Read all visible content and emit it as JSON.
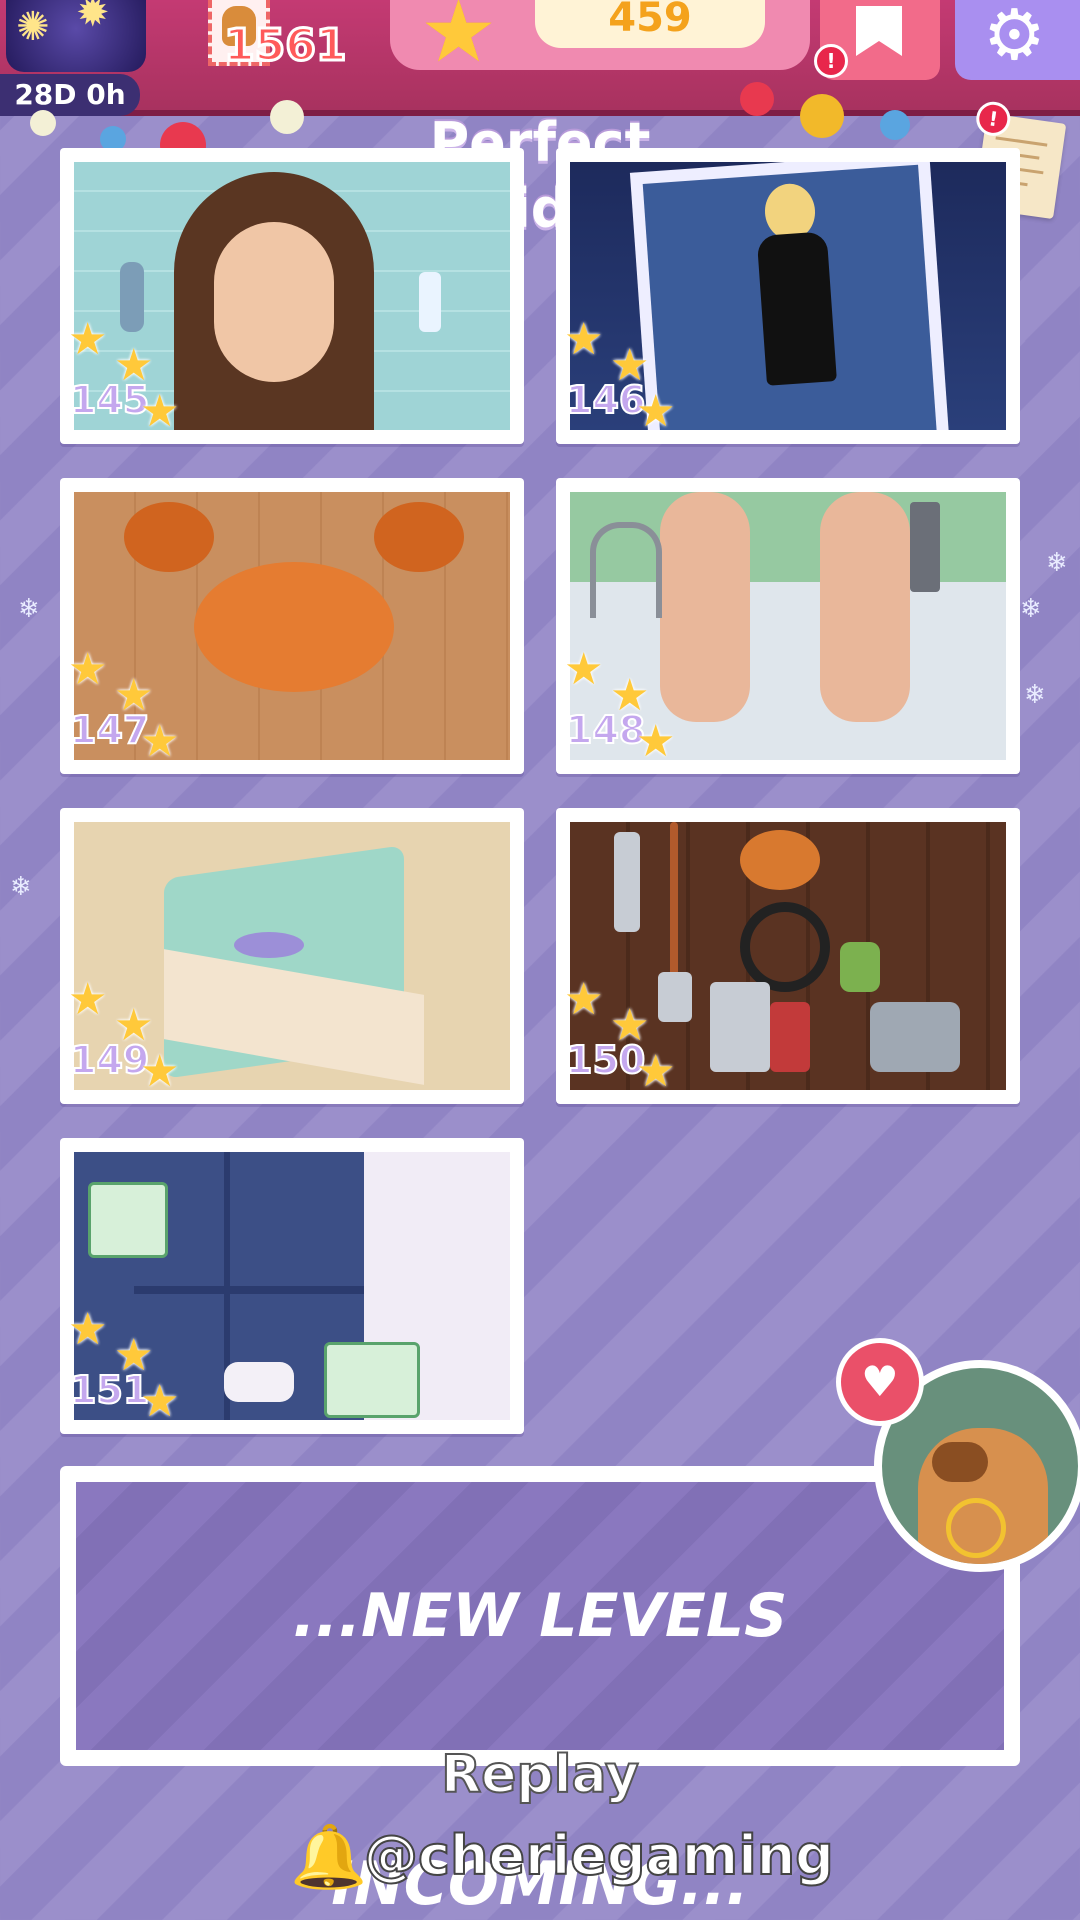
{
  "hud": {
    "event_timer": "28D 0h",
    "currency_value": "1561",
    "star_count": "459",
    "game_title": "Perfect Tidy",
    "shop_alert": "!",
    "notes_alert": "!"
  },
  "levels": [
    {
      "number": "145",
      "stars": 3,
      "art": "hair-care"
    },
    {
      "number": "146",
      "stars": 3,
      "art": "fashion-photo"
    },
    {
      "number": "147",
      "stars": 3,
      "art": "crab"
    },
    {
      "number": "148",
      "stars": 3,
      "art": "foot-care"
    },
    {
      "number": "149",
      "stars": 3,
      "art": "mini-room"
    },
    {
      "number": "150",
      "stars": 3,
      "art": "tool-shed"
    },
    {
      "number": "151",
      "stars": 3,
      "art": "ice-cream-freezer"
    }
  ],
  "banner": {
    "text": "...NEW LEVELS INCOMING..."
  },
  "footer": {
    "replay_label": "Replay",
    "channel_handle": "@cheriegaming"
  },
  "colors": {
    "background": "#9b8fcb",
    "hud": "#c43a73",
    "star": "#ffc93a",
    "level_number": "#c4a7ee"
  }
}
